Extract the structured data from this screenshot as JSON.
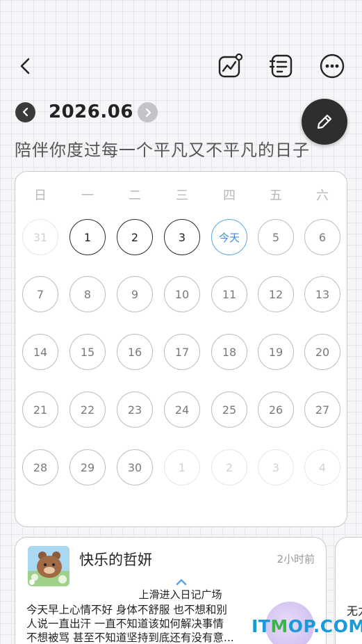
{
  "header": {
    "back_icon": "chevron-left-icon",
    "actions": [
      {
        "name": "chart-icon",
        "label": ""
      },
      {
        "name": "list-icon",
        "label": ""
      },
      {
        "name": "more-icon",
        "label": ""
      }
    ]
  },
  "calendar": {
    "month_label": "2026.06",
    "tagline": "陪伴你度过每一个平凡又不平凡的日子",
    "weekdays": [
      "日",
      "一",
      "二",
      "三",
      "四",
      "五",
      "六"
    ],
    "days": [
      {
        "label": "31",
        "state": "dim"
      },
      {
        "label": "1",
        "state": "dark"
      },
      {
        "label": "2",
        "state": "dark"
      },
      {
        "label": "3",
        "state": "dark"
      },
      {
        "label": "今天",
        "state": "today"
      },
      {
        "label": "5",
        "state": "normal"
      },
      {
        "label": "6",
        "state": "normal"
      },
      {
        "label": "7",
        "state": "normal"
      },
      {
        "label": "8",
        "state": "normal"
      },
      {
        "label": "9",
        "state": "normal"
      },
      {
        "label": "10",
        "state": "normal"
      },
      {
        "label": "11",
        "state": "normal"
      },
      {
        "label": "12",
        "state": "normal"
      },
      {
        "label": "13",
        "state": "normal"
      },
      {
        "label": "14",
        "state": "normal"
      },
      {
        "label": "15",
        "state": "normal"
      },
      {
        "label": "16",
        "state": "normal"
      },
      {
        "label": "17",
        "state": "normal"
      },
      {
        "label": "18",
        "state": "normal"
      },
      {
        "label": "19",
        "state": "normal"
      },
      {
        "label": "20",
        "state": "normal"
      },
      {
        "label": "21",
        "state": "normal"
      },
      {
        "label": "22",
        "state": "normal"
      },
      {
        "label": "23",
        "state": "normal"
      },
      {
        "label": "24",
        "state": "normal"
      },
      {
        "label": "25",
        "state": "normal"
      },
      {
        "label": "26",
        "state": "normal"
      },
      {
        "label": "27",
        "state": "normal"
      },
      {
        "label": "28",
        "state": "normal"
      },
      {
        "label": "29",
        "state": "normal"
      },
      {
        "label": "30",
        "state": "normal"
      },
      {
        "label": "1",
        "state": "dim"
      },
      {
        "label": "2",
        "state": "dim"
      },
      {
        "label": "3",
        "state": "dim"
      },
      {
        "label": "4",
        "state": "dim"
      }
    ],
    "today_color": "#3a8fdd"
  },
  "feed": {
    "swipe_hint": "上滑进入日记广场",
    "cards": [
      {
        "user": "快乐的哲妍",
        "time": "2小时前",
        "lines": [
          "今天早上心情不好 身体不舒服 也不想和别",
          "人说一直出汗 一直不知道该如何解决事情",
          "不想被骂 甚至不知道坚持到底还有没有意..."
        ]
      },
      {
        "user": "",
        "time": "",
        "lines": [
          "无力"
        ]
      }
    ]
  },
  "watermark": {
    "part1": "IT",
    "part2": "M",
    "part3": "OP.COM"
  }
}
